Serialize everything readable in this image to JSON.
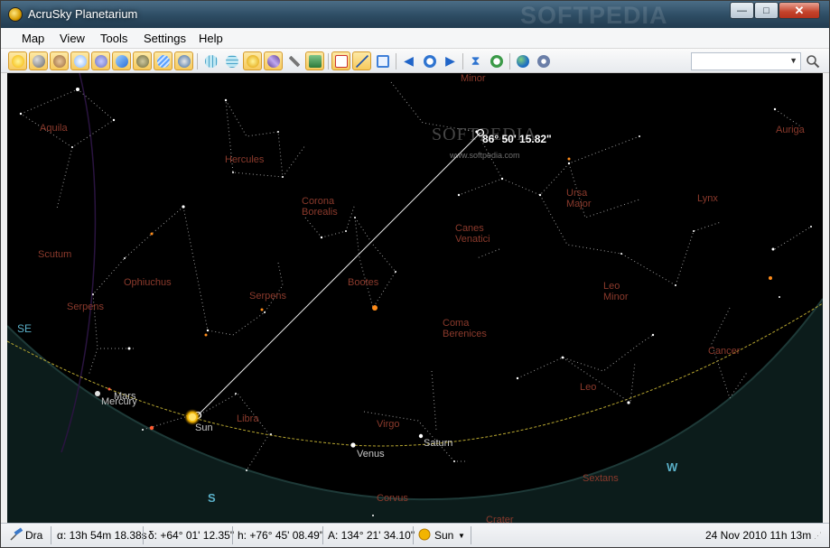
{
  "app": {
    "title": "AcruSky Planetarium",
    "watermark": "SOFTPEDIA"
  },
  "window_controls": {
    "minimize": "—",
    "maximize": "□",
    "close": "✕"
  },
  "menu": [
    "Map",
    "View",
    "Tools",
    "Settings",
    "Help"
  ],
  "toolbar": {
    "icons": [
      "sun-icon",
      "moon-icon",
      "planet-icon",
      "star-icon",
      "galaxy-icon",
      "comet-icon",
      "asteroid-icon",
      "meteor-icon",
      "satellite-icon",
      "grid-equatorial-icon",
      "grid-horizontal-icon",
      "ecliptic-icon",
      "milky-way-icon",
      "telescope-icon",
      "horizon-icon",
      "labels-icon",
      "measure-icon",
      "zoom-frame-icon",
      "back-icon",
      "time-now-icon",
      "forward-icon",
      "hourglass-icon",
      "clock-step-icon",
      "globe-icon",
      "settings-icon"
    ],
    "location_value": ""
  },
  "sky": {
    "measurement": "86° 50' 15.82\"",
    "watermark": "SOFTPEDIA",
    "watermark_url": "www.softpedia.com",
    "directions": {
      "se": "SE",
      "s": "S",
      "w": "W"
    },
    "constellations": {
      "aquila": "Aquila",
      "hercules": "Hercules",
      "corona_borealis_1": "Corona",
      "corona_borealis_2": "Borealis",
      "scutum": "Scutum",
      "ophiuchus": "Ophiuchus",
      "serpens_1": "Serpens",
      "serpens_2": "Serpens",
      "bootes": "Bootes",
      "canes_1": "Canes",
      "canes_2": "Venatici",
      "ursa_1": "Ursa",
      "ursa_2": "Major",
      "lynx": "Lynx",
      "leo_minor_1": "Leo",
      "leo_minor_2": "Minor",
      "coma_1": "Coma",
      "coma_2": "Berenices",
      "cancer": "Cancer",
      "leo": "Leo",
      "libra": "Libra",
      "virgo": "Virgo",
      "corvus": "Corvus",
      "sextans": "Sextans",
      "crater": "Crater",
      "auriga": "Auriga",
      "minor_top": "Minor"
    },
    "bodies": {
      "mars": "Mars",
      "mercury": "Mercury",
      "sun": "Sun",
      "venus": "Venus",
      "saturn": "Saturn"
    }
  },
  "status": {
    "object": "Dra",
    "ra": "α: 13h 54m 18.38s",
    "dec": "δ: +64° 01' 12.35\"",
    "alt": "h: +76° 45' 08.49\"",
    "az": "A: 134° 21' 34.10\"",
    "target": "Sun",
    "datetime": "24 Nov 2010 11h 13m"
  },
  "colors": {
    "sky": "#000000",
    "constellation_label": "#8b3a2c",
    "ecliptic": "#b7a630",
    "planet_label": "#c8c8c8",
    "direction": "#5ab0c8"
  }
}
